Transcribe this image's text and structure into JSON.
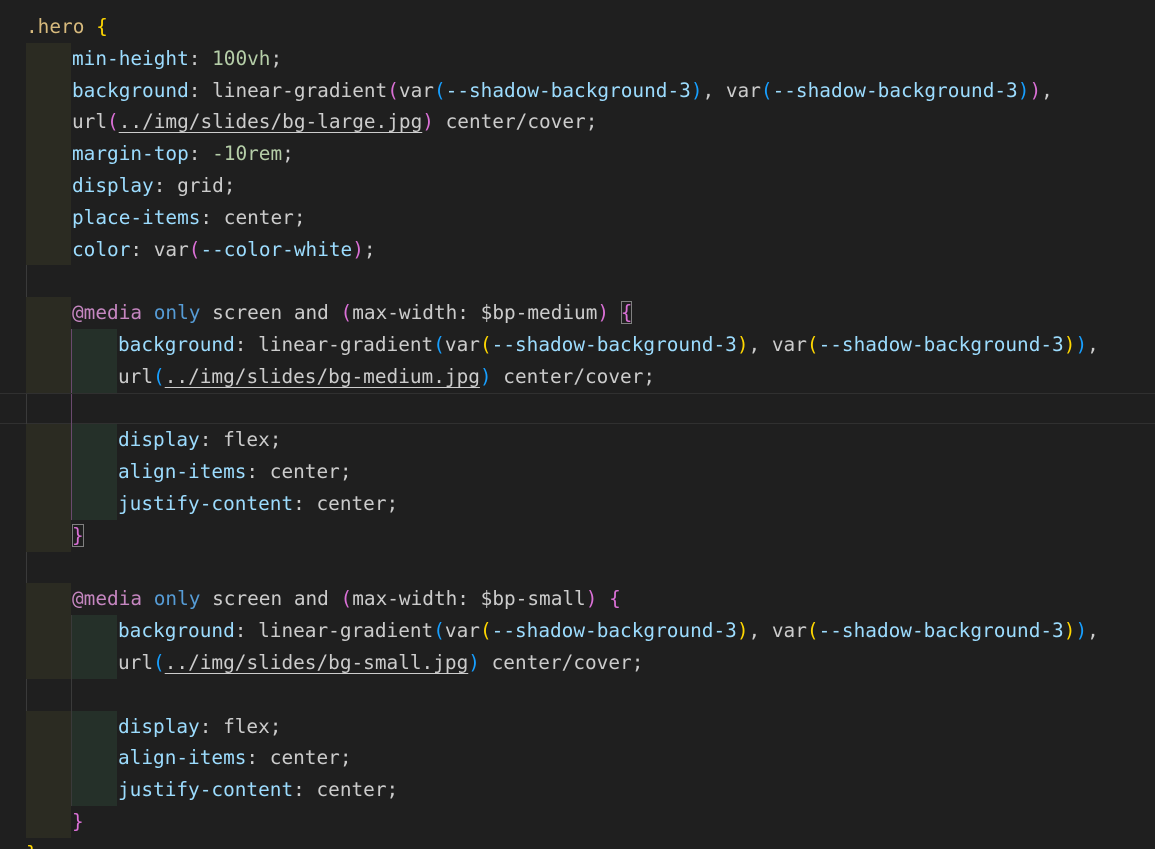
{
  "editor": {
    "lines": [
      [
        {
          "t": ".hero",
          "c": "sel"
        },
        {
          "t": " ",
          "c": "punc"
        },
        {
          "t": "{",
          "c": "b1"
        }
      ],
      [
        {
          "t": "min-height",
          "c": "prop"
        },
        {
          "t": ": ",
          "c": "punc"
        },
        {
          "t": "100vh",
          "c": "num"
        },
        {
          "t": ";",
          "c": "punc"
        }
      ],
      [
        {
          "t": "background",
          "c": "prop"
        },
        {
          "t": ": ",
          "c": "punc"
        },
        {
          "t": "linear-gradient",
          "c": "val"
        },
        {
          "t": "(",
          "c": "b2"
        },
        {
          "t": "var",
          "c": "val"
        },
        {
          "t": "(",
          "c": "b3"
        },
        {
          "t": "--shadow-background-3",
          "c": "var"
        },
        {
          "t": ")",
          "c": "b3"
        },
        {
          "t": ", ",
          "c": "punc"
        },
        {
          "t": "var",
          "c": "val"
        },
        {
          "t": "(",
          "c": "b3"
        },
        {
          "t": "--shadow-background-3",
          "c": "var"
        },
        {
          "t": ")",
          "c": "b3"
        },
        {
          "t": ")",
          "c": "b2"
        },
        {
          "t": ",",
          "c": "punc"
        }
      ],
      [
        {
          "t": "url",
          "c": "val"
        },
        {
          "t": "(",
          "c": "b2"
        },
        {
          "t": "../img/slides/bg-large.jpg",
          "c": "url"
        },
        {
          "t": ")",
          "c": "b2"
        },
        {
          "t": " center/cover;",
          "c": "val"
        }
      ],
      [
        {
          "t": "margin-top",
          "c": "prop"
        },
        {
          "t": ": ",
          "c": "punc"
        },
        {
          "t": "-10rem",
          "c": "num"
        },
        {
          "t": ";",
          "c": "punc"
        }
      ],
      [
        {
          "t": "display",
          "c": "prop"
        },
        {
          "t": ": grid;",
          "c": "val"
        }
      ],
      [
        {
          "t": "place-items",
          "c": "prop"
        },
        {
          "t": ": center;",
          "c": "val"
        }
      ],
      [
        {
          "t": "color",
          "c": "prop"
        },
        {
          "t": ": ",
          "c": "punc"
        },
        {
          "t": "var",
          "c": "val"
        },
        {
          "t": "(",
          "c": "b2"
        },
        {
          "t": "--color-white",
          "c": "var"
        },
        {
          "t": ")",
          "c": "b2"
        },
        {
          "t": ";",
          "c": "punc"
        }
      ],
      [],
      [
        {
          "t": "@media",
          "c": "kw"
        },
        {
          "t": " ",
          "c": "punc"
        },
        {
          "t": "only",
          "c": "kwb"
        },
        {
          "t": " screen and ",
          "c": "val"
        },
        {
          "t": "(",
          "c": "b2"
        },
        {
          "t": "max-width",
          "c": "val"
        },
        {
          "t": ": $bp-medium",
          "c": "val"
        },
        {
          "t": ")",
          "c": "b2"
        },
        {
          "t": " ",
          "c": "punc"
        },
        {
          "t": "{",
          "c": "b2",
          "box": true
        }
      ],
      [
        {
          "t": "background",
          "c": "prop"
        },
        {
          "t": ": ",
          "c": "punc"
        },
        {
          "t": "linear-gradient",
          "c": "val"
        },
        {
          "t": "(",
          "c": "b3"
        },
        {
          "t": "var",
          "c": "val"
        },
        {
          "t": "(",
          "c": "b1"
        },
        {
          "t": "--shadow-background-3",
          "c": "var"
        },
        {
          "t": ")",
          "c": "b1"
        },
        {
          "t": ", ",
          "c": "punc"
        },
        {
          "t": "var",
          "c": "val"
        },
        {
          "t": "(",
          "c": "b1"
        },
        {
          "t": "--shadow-background-3",
          "c": "var"
        },
        {
          "t": ")",
          "c": "b1"
        },
        {
          "t": ")",
          "c": "b3"
        },
        {
          "t": ",",
          "c": "punc"
        }
      ],
      [
        {
          "t": "url",
          "c": "val"
        },
        {
          "t": "(",
          "c": "b3"
        },
        {
          "t": "../img/slides/bg-medium.jpg",
          "c": "url"
        },
        {
          "t": ")",
          "c": "b3"
        },
        {
          "t": " center/cover;",
          "c": "val"
        }
      ],
      [],
      [
        {
          "t": "display",
          "c": "prop"
        },
        {
          "t": ": flex;",
          "c": "val"
        }
      ],
      [
        {
          "t": "align-items",
          "c": "prop"
        },
        {
          "t": ": center;",
          "c": "val"
        }
      ],
      [
        {
          "t": "justify-content",
          "c": "prop"
        },
        {
          "t": ": center;",
          "c": "val"
        }
      ],
      [
        {
          "t": "}",
          "c": "b2",
          "box": true
        }
      ],
      [],
      [
        {
          "t": "@media",
          "c": "kw"
        },
        {
          "t": " ",
          "c": "punc"
        },
        {
          "t": "only",
          "c": "kwb"
        },
        {
          "t": " screen and ",
          "c": "val"
        },
        {
          "t": "(",
          "c": "b2"
        },
        {
          "t": "max-width",
          "c": "val"
        },
        {
          "t": ": $bp-small",
          "c": "val"
        },
        {
          "t": ")",
          "c": "b2"
        },
        {
          "t": " ",
          "c": "punc"
        },
        {
          "t": "{",
          "c": "b2"
        }
      ],
      [
        {
          "t": "background",
          "c": "prop"
        },
        {
          "t": ": ",
          "c": "punc"
        },
        {
          "t": "linear-gradient",
          "c": "val"
        },
        {
          "t": "(",
          "c": "b3"
        },
        {
          "t": "var",
          "c": "val"
        },
        {
          "t": "(",
          "c": "b1"
        },
        {
          "t": "--shadow-background-3",
          "c": "var"
        },
        {
          "t": ")",
          "c": "b1"
        },
        {
          "t": ", ",
          "c": "punc"
        },
        {
          "t": "var",
          "c": "val"
        },
        {
          "t": "(",
          "c": "b1"
        },
        {
          "t": "--shadow-background-3",
          "c": "var"
        },
        {
          "t": ")",
          "c": "b1"
        },
        {
          "t": ")",
          "c": "b3"
        },
        {
          "t": ",",
          "c": "punc"
        }
      ],
      [
        {
          "t": "url",
          "c": "val"
        },
        {
          "t": "(",
          "c": "b3"
        },
        {
          "t": "../img/slides/bg-small.jpg",
          "c": "url"
        },
        {
          "t": ")",
          "c": "b3"
        },
        {
          "t": " center/cover;",
          "c": "val"
        }
      ],
      [],
      [
        {
          "t": "display",
          "c": "prop"
        },
        {
          "t": ": flex;",
          "c": "val"
        }
      ],
      [
        {
          "t": "align-items",
          "c": "prop"
        },
        {
          "t": ": center;",
          "c": "val"
        }
      ],
      [
        {
          "t": "justify-content",
          "c": "prop"
        },
        {
          "t": ": center;",
          "c": "val"
        }
      ],
      [
        {
          "t": "}",
          "c": "b2"
        }
      ],
      [
        {
          "t": "}",
          "c": "b1"
        }
      ]
    ]
  }
}
